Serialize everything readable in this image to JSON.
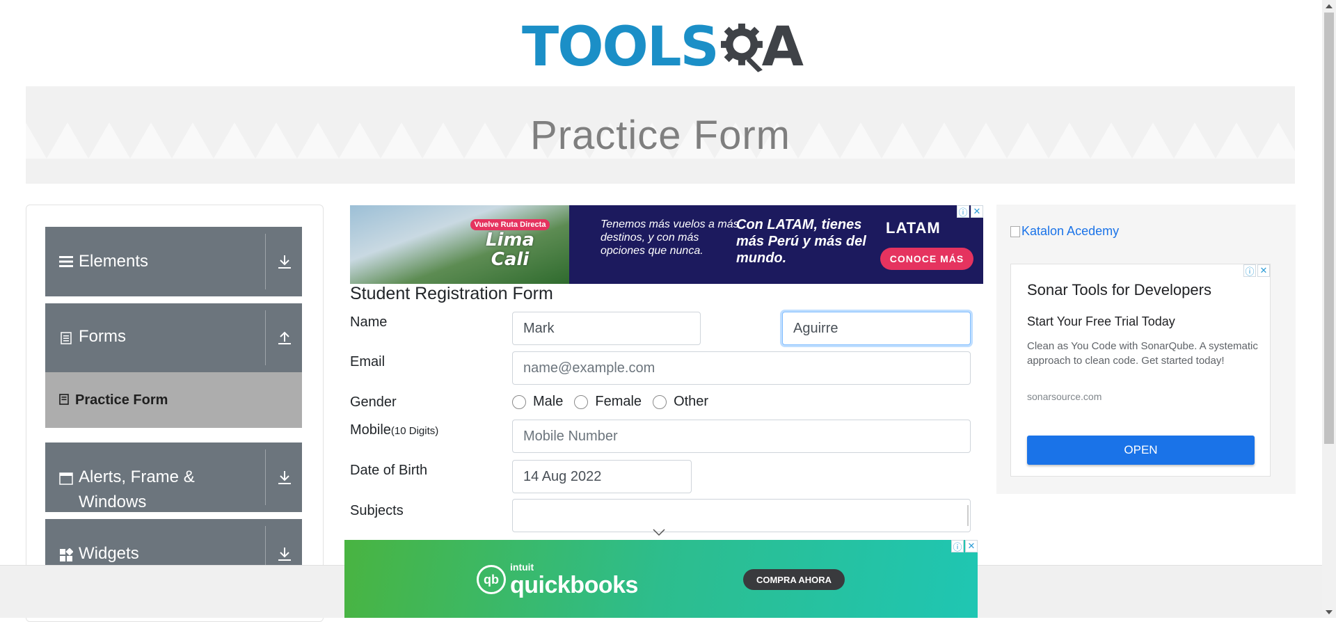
{
  "header": {
    "logo_text": "TOOLS",
    "logo_letter": "A",
    "page_banner_title": "Practice Form"
  },
  "sidebar": {
    "groups": [
      {
        "label": "Elements",
        "icon": "hamburger-icon",
        "arrow": "download-arrow-icon"
      },
      {
        "label": "Forms",
        "icon": "document-icon",
        "arrow": "upload-arrow-icon"
      },
      {
        "label": "Alerts, Frame &",
        "label_line2": "Windows",
        "icon": "window-icon",
        "arrow": "download-arrow-icon"
      },
      {
        "label": "Widgets",
        "icon": "widgets-icon",
        "arrow": "download-arrow-icon"
      }
    ],
    "active_item": {
      "label": "Practice Form",
      "icon": "form-icon"
    }
  },
  "ad_top": {
    "badge": "Vuelve Ruta Directa",
    "city1": "Lima",
    "city2": "Cali",
    "copy1": "Tenemos más vuelos a más destinos, y con más opciones que nunca.",
    "copy2": "Con LATAM, tienes más Perú y más del mundo.",
    "brand": "LATAM",
    "cta": "CONOCE MÁS"
  },
  "form": {
    "title": "Student Registration Form",
    "name_label": "Name",
    "first_name_value": "Mark",
    "last_name_value": "Aguirre",
    "email_label": "Email",
    "email_placeholder": "name@example.com",
    "gender_label": "Gender",
    "gender_options": [
      "Male",
      "Female",
      "Other"
    ],
    "mobile_label": "Mobile",
    "mobile_hint": "(10 Digits)",
    "mobile_placeholder": "Mobile Number",
    "dob_label": "Date of Birth",
    "dob_value": "14 Aug 2022",
    "subjects_label": "Subjects"
  },
  "side_ad": {
    "katalon_alt": "Katalon Acedemy",
    "title": "Sonar Tools for Developers",
    "subtitle": "Start Your Free Trial Today",
    "description": "Clean as You Code with SonarQube. A systematic approach to clean code. Get started today!",
    "domain": "sonarsource.com",
    "button": "OPEN"
  },
  "ad_bottom": {
    "intuit": "intuit",
    "brand": "quickbooks",
    "cta": "COMPRA AHORA"
  },
  "colors": {
    "accent_blue": "#1b8fc7",
    "sidebar_gray": "#6c757d",
    "active_item_gray": "#adadad",
    "open_button_blue": "#1a73e8"
  }
}
